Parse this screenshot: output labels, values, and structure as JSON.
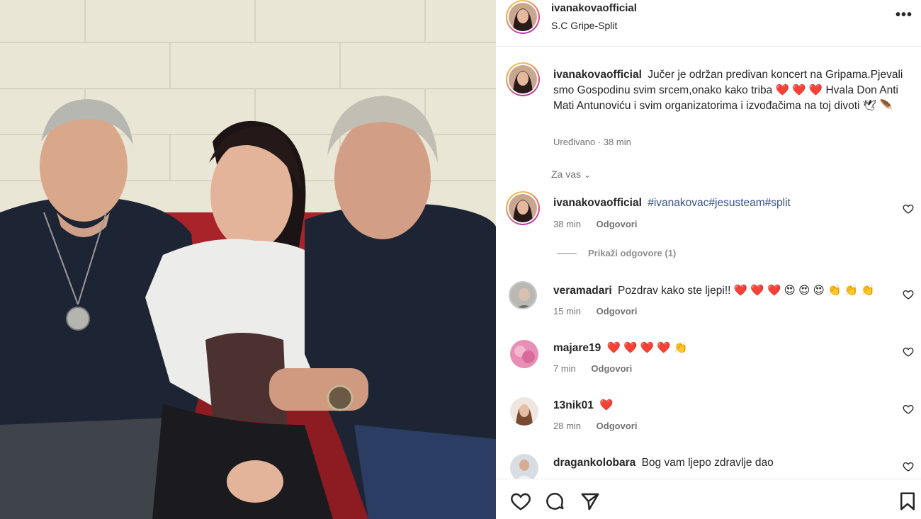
{
  "header": {
    "username": "ivanakovaofficial",
    "location": "S.C Gripe-Split",
    "more_label": "•••",
    "avatar_icon": "profile-avatar"
  },
  "caption": {
    "username": "ivanakovaofficial",
    "text": "Jučer je održan predivan koncert na Gripama.Pjevali smo Gospodinu svim srcem,onako kako triba",
    "text2": "Hvala Don Anti Mati Antunoviću i svim organizatorima i izvođačima na toj divoti",
    "hearts": "❤️ ❤️",
    "heart3": "❤️",
    "tail_icons": "🕊 🪶",
    "edited": "Uređivano · 38 min",
    "for_you": "Za vas"
  },
  "comments": [
    {
      "username": "ivanakovaofficial",
      "text": "#ivanakovac#jesusteam#split",
      "time": "38 min",
      "reply": "Odgovori",
      "view_replies": "Prikaži odgovore (1)"
    },
    {
      "username": "veramadari",
      "text": "Pozdrav kako ste ljepi!! ❤️ ❤️ ❤️ 😍 😍 😍 👏 👏 👏",
      "time": "15 min",
      "reply": "Odgovori"
    },
    {
      "username": "majare19",
      "text": "❤️ ❤️ ❤️ ❤️ 👏",
      "time": "7 min",
      "reply": "Odgovori"
    },
    {
      "username": "13nik01",
      "text": "❤️",
      "time": "28 min",
      "reply": "Odgovori"
    },
    {
      "username": "dragankolobara",
      "text": "Bog vam ljepo zdravlje dao",
      "time": "",
      "reply": ""
    }
  ],
  "actions": {
    "like_icon": "heart-icon",
    "comment_icon": "comment-icon",
    "share_icon": "send-icon",
    "save_icon": "bookmark-icon"
  },
  "colors": {
    "accent_link": "#385185",
    "heart": "#e0143c",
    "muted": "#737373"
  }
}
